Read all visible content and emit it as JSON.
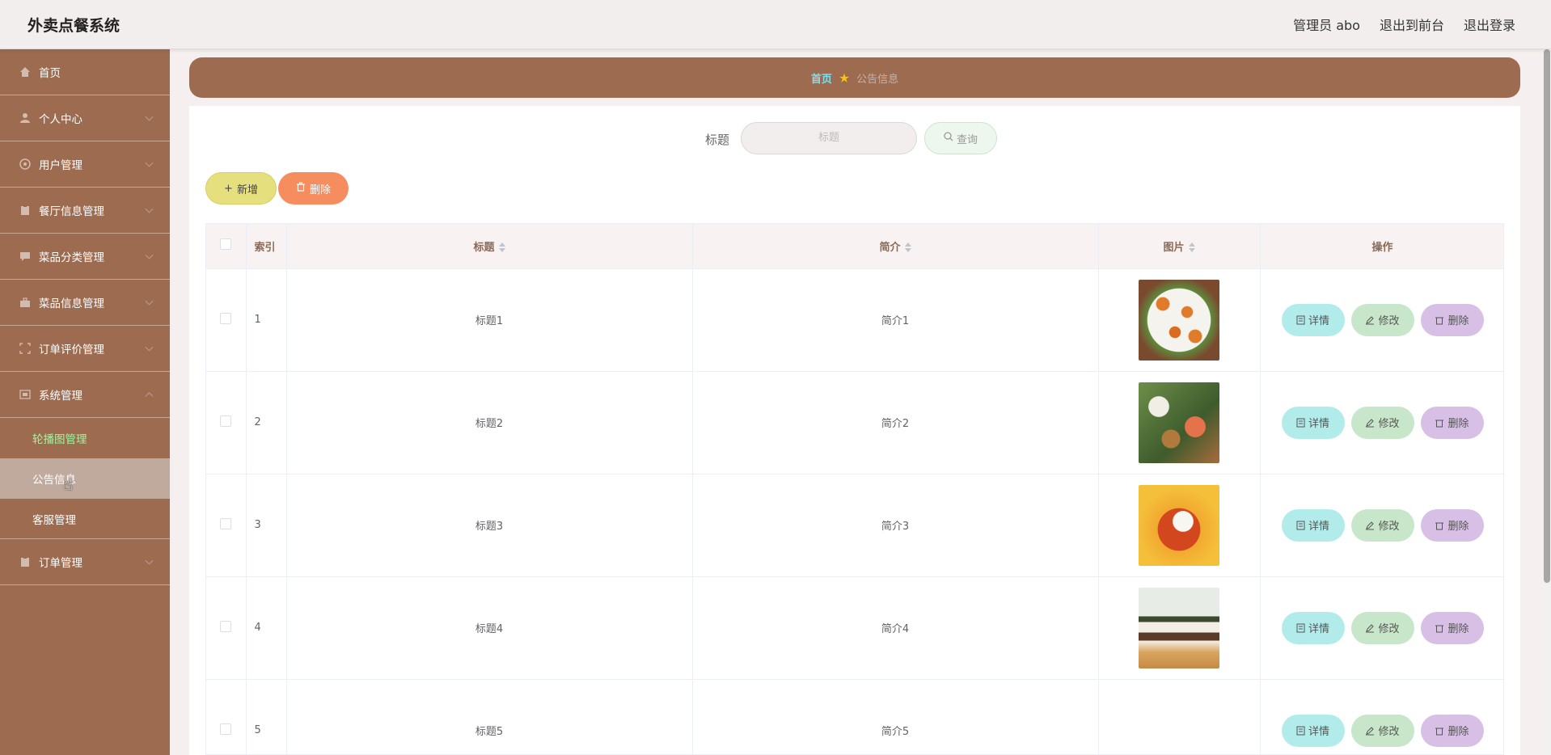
{
  "app": {
    "title": "外卖点餐系统",
    "user": "管理员 abo",
    "nav_front": "退出到前台",
    "nav_logout": "退出登录"
  },
  "sidebar": {
    "items": [
      {
        "label": "首页",
        "icon": "home-icon"
      },
      {
        "label": "个人中心",
        "icon": "user-icon"
      },
      {
        "label": "用户管理",
        "icon": "users-icon"
      },
      {
        "label": "餐厅信息管理",
        "icon": "clipboard-icon"
      },
      {
        "label": "菜品分类管理",
        "icon": "chat-icon"
      },
      {
        "label": "菜品信息管理",
        "icon": "briefcase-icon"
      },
      {
        "label": "订单评价管理",
        "icon": "frame-icon"
      },
      {
        "label": "系统管理",
        "icon": "settings-icon"
      },
      {
        "label": "订单管理",
        "icon": "clipboard-icon"
      }
    ],
    "subitems": [
      {
        "label": "轮播图管理"
      },
      {
        "label": "公告信息"
      },
      {
        "label": "客服管理"
      }
    ]
  },
  "breadcrumb": {
    "home": "首页",
    "current": "公告信息"
  },
  "search": {
    "label": "标题",
    "placeholder": "标题",
    "button": "查询"
  },
  "actions": {
    "add": "新增",
    "delete": "删除"
  },
  "table": {
    "columns": {
      "index": "索引",
      "title": "标题",
      "intro": "简介",
      "image": "图片",
      "ops": "操作"
    },
    "rows": [
      {
        "index": "1",
        "title": "标题1",
        "intro": "简介1"
      },
      {
        "index": "2",
        "title": "标题2",
        "intro": "简介2"
      },
      {
        "index": "3",
        "title": "标题3",
        "intro": "简介3"
      },
      {
        "index": "4",
        "title": "标题4",
        "intro": "简介4"
      },
      {
        "index": "5",
        "title": "标题5",
        "intro": "简介5"
      }
    ],
    "buttons": {
      "detail": "详情",
      "edit": "修改",
      "delete": "删除"
    }
  },
  "colors": {
    "sidebar": "#9c6b50",
    "header": "#f3eeee",
    "breadcrumb_home": "#7ee0ef",
    "submenu_green": "#a7f2a0"
  }
}
